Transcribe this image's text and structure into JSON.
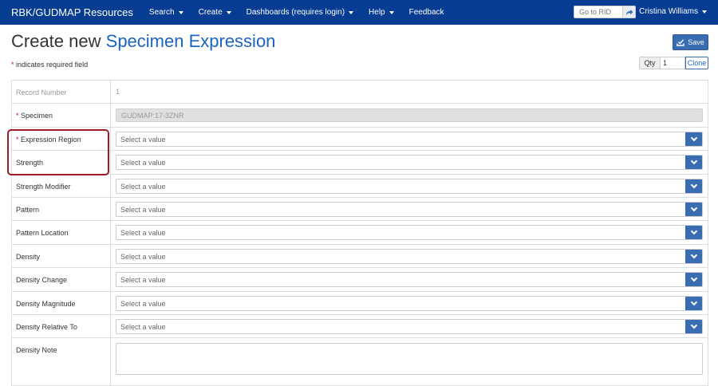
{
  "navbar": {
    "brand": "RBK/GUDMAP Resources",
    "menus": [
      {
        "label": "Search",
        "has_caret": true
      },
      {
        "label": "Create",
        "has_caret": true
      },
      {
        "label": "Dashboards (requires login)",
        "has_caret": true
      },
      {
        "label": "Help",
        "has_caret": true
      },
      {
        "label": "Feedback",
        "has_caret": false
      }
    ],
    "rid_placeholder": "Go to RID",
    "user": "Cristina Williams"
  },
  "page": {
    "title_prefix": "Create new",
    "title_entity": "Specimen Expression",
    "required_note": "indicates required field",
    "required_mark": "*",
    "save_label": "Save",
    "qty_label": "Qty",
    "qty_value": "1",
    "clone_label": "Clone"
  },
  "form": {
    "rows": [
      {
        "label": "Record Number",
        "required": false,
        "type": "readonly",
        "value": "1"
      },
      {
        "label": "Specimen",
        "required": true,
        "type": "disabled",
        "value": "GUDMAP:17-3ZNR"
      },
      {
        "label": "Expression Region",
        "required": true,
        "type": "select",
        "value": "Select a value"
      },
      {
        "label": "Strength",
        "required": false,
        "type": "select",
        "value": "Select a value"
      },
      {
        "label": "Strength Modifier",
        "required": false,
        "type": "select",
        "value": "Select a value"
      },
      {
        "label": "Pattern",
        "required": false,
        "type": "select",
        "value": "Select a value"
      },
      {
        "label": "Pattern Location",
        "required": false,
        "type": "select",
        "value": "Select a value"
      },
      {
        "label": "Density",
        "required": false,
        "type": "select",
        "value": "Select a value"
      },
      {
        "label": "Density Change",
        "required": false,
        "type": "select",
        "value": "Select a value"
      },
      {
        "label": "Density Magnitude",
        "required": false,
        "type": "select",
        "value": "Select a value"
      },
      {
        "label": "Density Relative To",
        "required": false,
        "type": "select",
        "value": "Select a value"
      },
      {
        "label": "Density Note",
        "required": false,
        "type": "textarea",
        "value": ""
      }
    ]
  },
  "colors": {
    "navbar_bg": "#063c91",
    "accent_blue": "#1a64c4",
    "button_blue": "#3a6cb2",
    "required_red": "#c9141e",
    "highlight_border": "#9b1c25"
  },
  "icons": {
    "rid_button": "share-arrow-icon",
    "save_button": "check-tray-icon",
    "select_toggle": "chevron-down-icon",
    "menu_caret": "caret-down-icon"
  }
}
